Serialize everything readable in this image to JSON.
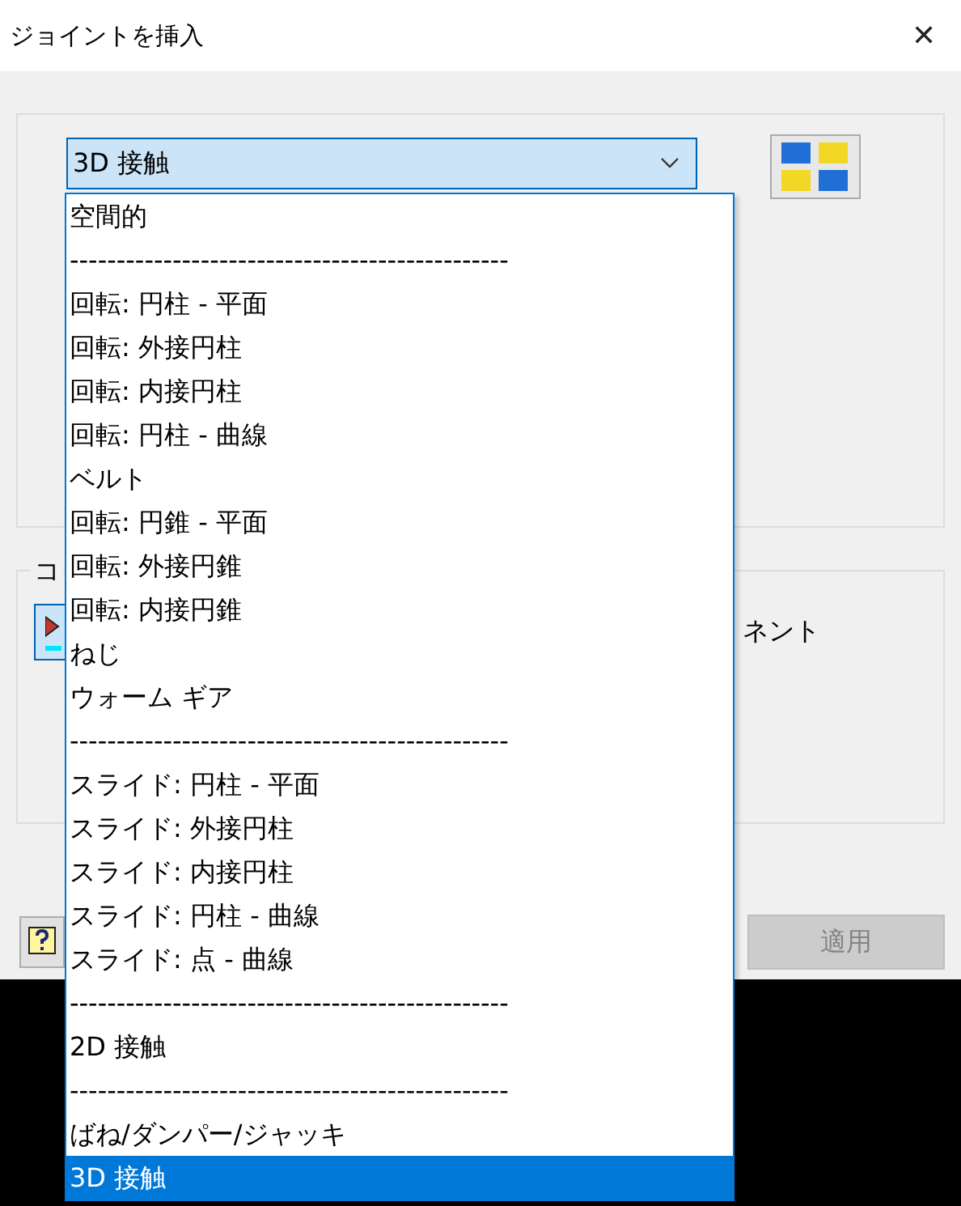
{
  "window": {
    "title": "ジョイントを挿入",
    "close": "✕"
  },
  "joint_type": {
    "value": "3D 接触",
    "expanded": true,
    "options": [
      {
        "label": "空間的",
        "selected": false
      },
      {
        "label": "-----------------------------------------------",
        "selected": false
      },
      {
        "label": "回転: 円柱 - 平面",
        "selected": false
      },
      {
        "label": "回転: 外接円柱",
        "selected": false
      },
      {
        "label": "回転: 内接円柱",
        "selected": false
      },
      {
        "label": "回転: 円柱 - 曲線",
        "selected": false
      },
      {
        "label": "ベルト",
        "selected": false
      },
      {
        "label": "回転: 円錐 - 平面",
        "selected": false
      },
      {
        "label": "回転: 外接円錐",
        "selected": false
      },
      {
        "label": "回転: 内接円錐",
        "selected": false
      },
      {
        "label": "ねじ",
        "selected": false
      },
      {
        "label": "ウォーム ギア",
        "selected": false
      },
      {
        "label": "-----------------------------------------------",
        "selected": false
      },
      {
        "label": "スライド: 円柱 - 平面",
        "selected": false
      },
      {
        "label": "スライド: 外接円柱",
        "selected": false
      },
      {
        "label": "スライド: 内接円柱",
        "selected": false
      },
      {
        "label": "スライド: 円柱 - 曲線",
        "selected": false
      },
      {
        "label": "スライド: 点 - 曲線",
        "selected": false
      },
      {
        "label": "-----------------------------------------------",
        "selected": false
      },
      {
        "label": "2D 接触",
        "selected": false
      },
      {
        "label": "-----------------------------------------------",
        "selected": false
      },
      {
        "label": "ばね/ダンパー/ジャッキ",
        "selected": false
      },
      {
        "label": "3D 接触",
        "selected": true
      }
    ]
  },
  "component_group": {
    "label": "コ",
    "side_text": "ネント"
  },
  "apply_button": {
    "label": "適用",
    "disabled": true
  }
}
